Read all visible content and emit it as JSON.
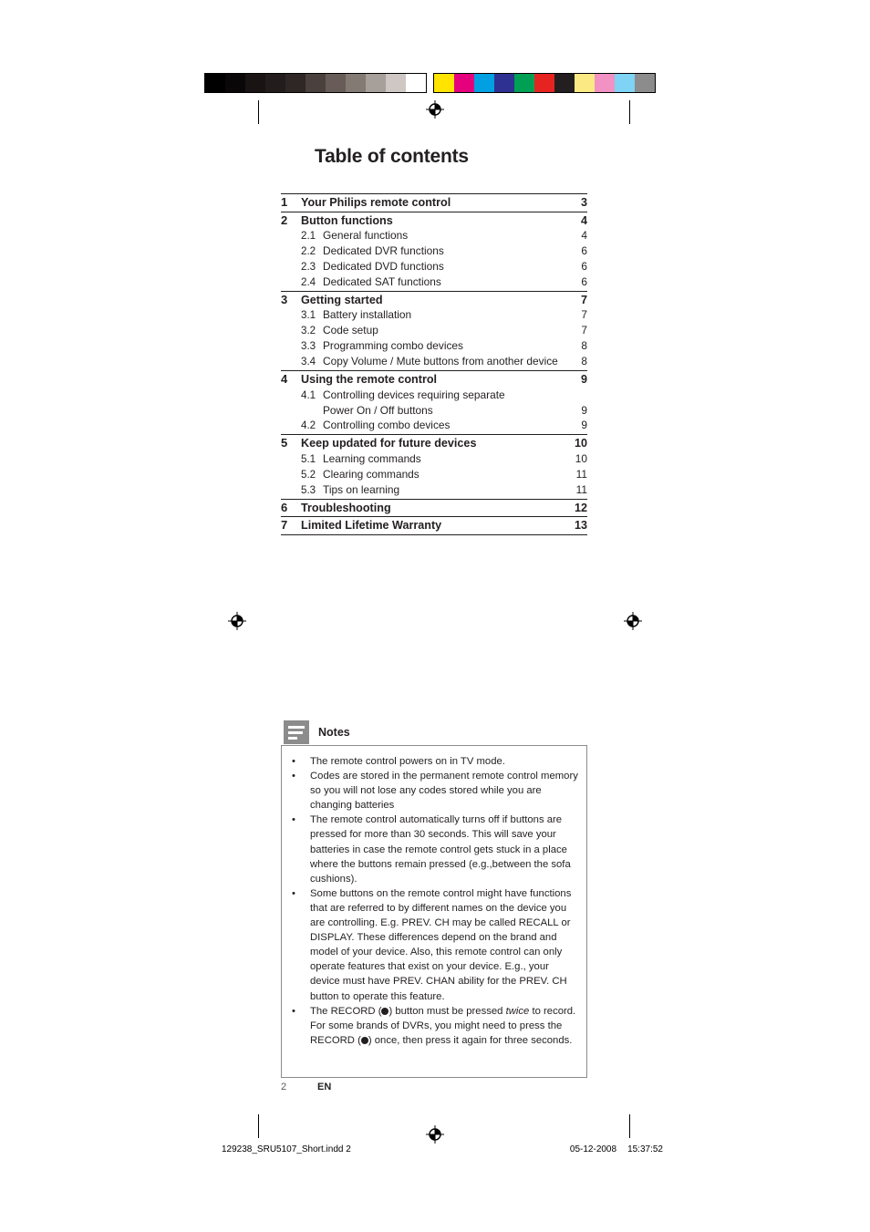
{
  "calibration": {
    "grayscale_swatches": [
      "#000000",
      "#0a0708",
      "#191314",
      "#231c1c",
      "#2e2726",
      "#4a403d",
      "#675c58",
      "#847a74",
      "#a79f99",
      "#cfc7c3",
      "#ffffff"
    ],
    "color_swatches": [
      "#ffe400",
      "#e5007d",
      "#00a0e3",
      "#2e3191",
      "#00a054",
      "#e52421",
      "#231f20",
      "#fbe984",
      "#f291c4",
      "#7fd3f4",
      "#8c8c8c"
    ]
  },
  "title": "Table of contents",
  "toc": {
    "entries": [
      {
        "num": "1",
        "sub": "",
        "label": "Your Philips remote control",
        "page": "3",
        "level": 1,
        "rule_top": true
      },
      {
        "num": "2",
        "sub": "",
        "label": "Button functions",
        "page": "4",
        "level": 1,
        "rule_top": true
      },
      {
        "num": "",
        "sub": "2.1",
        "label": "General functions",
        "page": "4",
        "level": 2,
        "rule_top": false
      },
      {
        "num": "",
        "sub": "2.2",
        "label": "Dedicated DVR functions",
        "page": "6",
        "level": 2,
        "rule_top": false
      },
      {
        "num": "",
        "sub": "2.3",
        "label": "Dedicated DVD functions",
        "page": "6",
        "level": 2,
        "rule_top": false
      },
      {
        "num": "",
        "sub": "2.4",
        "label": "Dedicated SAT functions",
        "page": "6",
        "level": 2,
        "rule_top": false
      },
      {
        "num": "3",
        "sub": "",
        "label": "Getting started",
        "page": "7",
        "level": 1,
        "rule_top": true
      },
      {
        "num": "",
        "sub": "3.1",
        "label": "Battery installation",
        "page": "7",
        "level": 2,
        "rule_top": false
      },
      {
        "num": "",
        "sub": "3.2",
        "label": "Code setup",
        "page": "7",
        "level": 2,
        "rule_top": false
      },
      {
        "num": "",
        "sub": "3.3",
        "label": "Programming combo devices",
        "page": "8",
        "level": 2,
        "rule_top": false
      },
      {
        "num": "",
        "sub": "3.4",
        "label": "Copy Volume / Mute buttons from another device",
        "page": "8",
        "level": 2,
        "rule_top": false
      },
      {
        "num": "4",
        "sub": "",
        "label": "Using the remote control",
        "page": "9",
        "level": 1,
        "rule_top": true
      },
      {
        "num": "",
        "sub": "4.1",
        "label": "Controlling devices requiring separate",
        "page": "",
        "level": 2,
        "rule_top": false
      },
      {
        "num": "",
        "sub": "",
        "label": "Power On / Off buttons",
        "page": "9",
        "level": 2,
        "rule_top": false,
        "continuation": true
      },
      {
        "num": "",
        "sub": "4.2",
        "label": "Controlling combo devices",
        "page": "9",
        "level": 2,
        "rule_top": false
      },
      {
        "num": "5",
        "sub": "",
        "label": "Keep updated for future devices",
        "page": "10",
        "level": 1,
        "rule_top": true
      },
      {
        "num": "",
        "sub": "5.1",
        "label": "Learning commands",
        "page": "10",
        "level": 2,
        "rule_top": false
      },
      {
        "num": "",
        "sub": "5.2",
        "label": "Clearing commands",
        "page": "11",
        "level": 2,
        "rule_top": false
      },
      {
        "num": "",
        "sub": "5.3",
        "label": "Tips on learning",
        "page": "11",
        "level": 2,
        "rule_top": false
      },
      {
        "num": "6",
        "sub": "",
        "label": "Troubleshooting",
        "page": "12",
        "level": 1,
        "rule_top": true
      },
      {
        "num": "7",
        "sub": "",
        "label": "Limited Lifetime Warranty",
        "page": "13",
        "level": 1,
        "rule_top": true,
        "rule_bottom": true
      }
    ]
  },
  "notes": {
    "icon": "notes-icon",
    "title": "Notes",
    "bullet": "•",
    "items": [
      {
        "text": "The remote control powers on in TV mode."
      },
      {
        "text": "Codes are stored in the permanent remote control memory so you will not lose any codes stored while you are changing batteries"
      },
      {
        "text": "The remote control automatically turns off if buttons are pressed for more than 30 seconds. This will save your batteries in case the remote control gets stuck in a place where the buttons remain pressed (e.g.,between the sofa cushions)."
      },
      {
        "text": "Some buttons on the remote control might have functions that are referred to by different names on the device you are controlling. E.g. PREV. CH may be called RECALL or DISPLAY. These differences depend on the brand and model of your device.  Also, this remote control can only operate features that exist on your device. E.g., your device must have PREV. CHAN ability for the PREV. CH button to operate this feature."
      },
      {
        "rich": true,
        "parts": [
          {
            "t": "The RECORD ("
          },
          {
            "dot": true
          },
          {
            "t": ") button must be pressed "
          },
          {
            "t": "twice",
            "italic": true
          },
          {
            "t": " to record. For some brands of DVRs, you might need to press the RECORD ("
          },
          {
            "dot": true
          },
          {
            "t": ") once, then press it again for three seconds."
          }
        ]
      }
    ]
  },
  "footer": {
    "page_number": "2",
    "language": "EN"
  },
  "print_footer": {
    "filename": "129238_SRU5107_Short.indd",
    "sheet": "2",
    "date": "05-12-2008",
    "time": "15:37:52"
  }
}
